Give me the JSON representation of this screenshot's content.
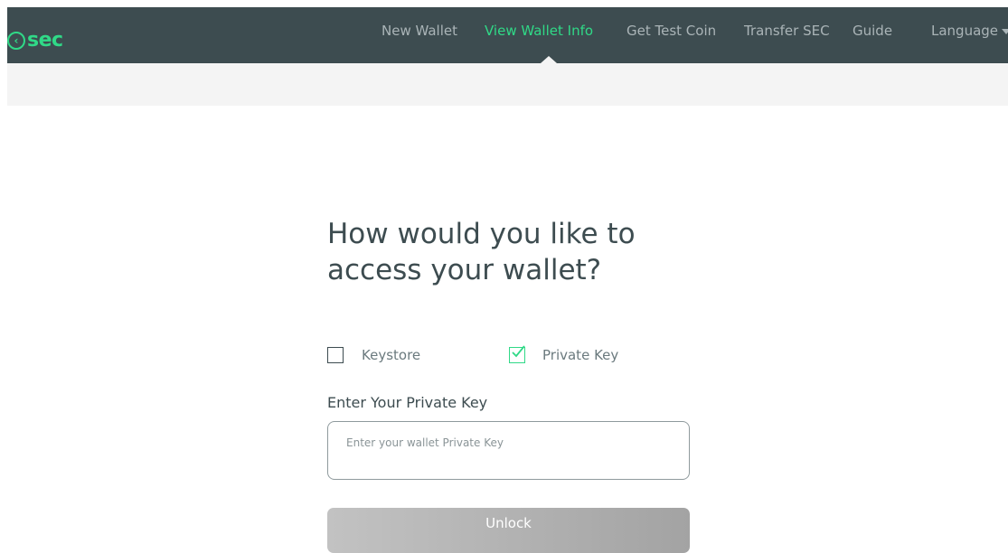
{
  "brand": {
    "logo_text": "sec",
    "accent_color": "#30d987",
    "nav_bg_color": "#3d4c50"
  },
  "nav": {
    "items": [
      {
        "label": "New Wallet",
        "active": false
      },
      {
        "label": "View Wallet Info",
        "active": true
      },
      {
        "label": "Get Test Coin",
        "active": false
      },
      {
        "label": "Transfer SEC",
        "active": false
      },
      {
        "label": "Guide",
        "active": false
      },
      {
        "label": "Language",
        "active": false,
        "icon": "caret-down-icon"
      }
    ]
  },
  "main": {
    "heading": "How would you like to access your wallet?",
    "access_options": [
      {
        "label": "Keystore",
        "checked": false
      },
      {
        "label": "Private Key",
        "checked": true
      }
    ],
    "field_label": "Enter Your Private Key",
    "input_placeholder": "Enter your wallet Private Key",
    "input_value": "",
    "unlock_label": "Unlock"
  }
}
